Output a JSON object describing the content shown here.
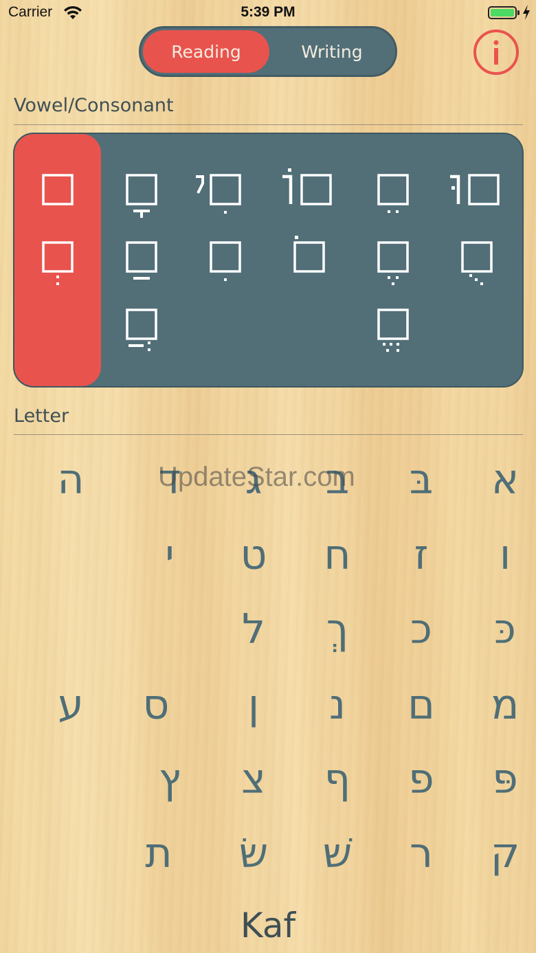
{
  "status_bar": {
    "carrier": "Carrier",
    "time": "5:39 PM",
    "wifi_icon": "wifi-icon",
    "battery_icon": "battery-charging-icon"
  },
  "mode_switch": {
    "options": [
      "Reading",
      "Writing"
    ],
    "selected": "Reading"
  },
  "info_button": {
    "icon": "info-icon",
    "color": "#e9534e"
  },
  "sections": {
    "vowel_title": "Vowel/Consonant",
    "letter_title": "Letter"
  },
  "vowels": {
    "selected_index": 0,
    "accent_color": "#e9534e",
    "panel_color": "#526f78",
    "marks": [
      "plain",
      "qamats",
      "hiriq-yod",
      "holam-vav",
      "tsere",
      "shuruq",
      "sheva",
      "patah",
      "hiriq",
      "holam",
      "segol",
      "kubutz",
      "hataf-patah",
      "hataf-segol"
    ]
  },
  "letters": {
    "color": "#4f6e77",
    "rows": [
      [
        "א",
        "בּ",
        "ב",
        "ג",
        "ד",
        "ה"
      ],
      [
        "ו",
        "ז",
        "ח",
        "ט",
        "י",
        ""
      ],
      [
        "כּ",
        "כ",
        "ךְ",
        "ל",
        "",
        ""
      ],
      [
        "מ",
        "ם",
        "נ",
        "ן",
        "ס",
        "ע"
      ],
      [
        "פּ",
        "פ",
        "ף",
        "צ",
        "ץ",
        ""
      ],
      [
        "ק",
        "ר",
        "שׁ",
        "שׂ",
        "ת",
        ""
      ]
    ]
  },
  "watermark": "UpdateStar.com",
  "current_letter": "Kaf"
}
